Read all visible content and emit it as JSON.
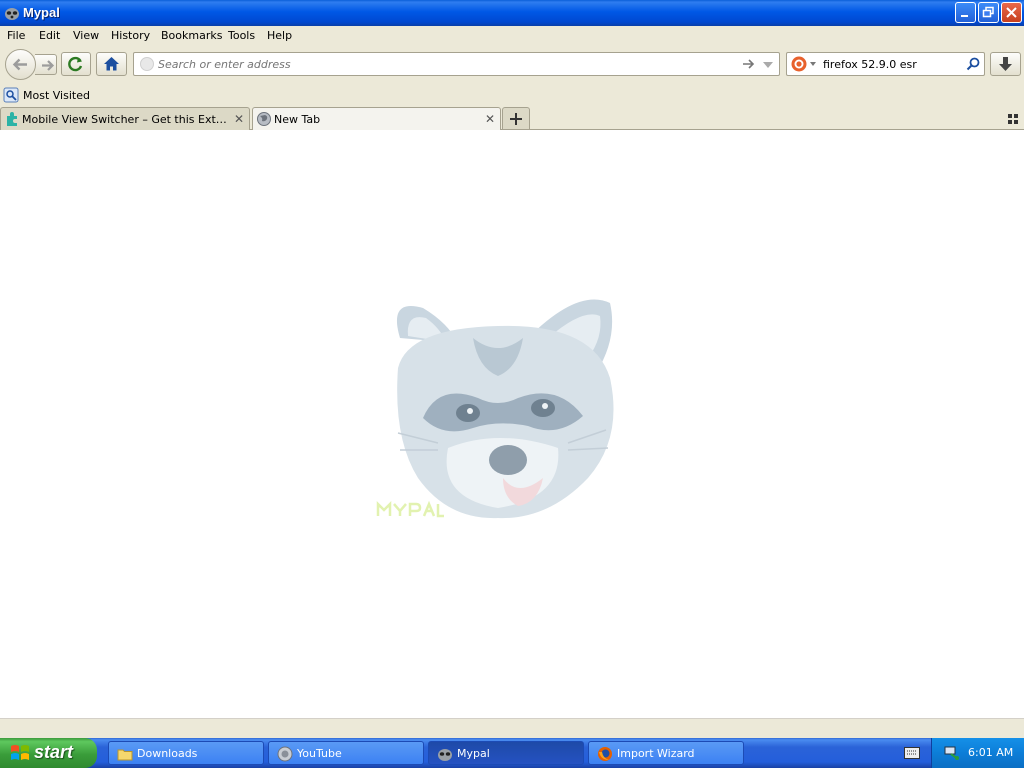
{
  "window": {
    "title": "Mypal"
  },
  "menu": {
    "file": "File",
    "edit": "Edit",
    "view": "View",
    "history": "History",
    "bookmarks": "Bookmarks",
    "tools": "Tools",
    "help": "Help"
  },
  "nav": {
    "url_placeholder": "Search or enter address",
    "url_value": "",
    "search_value": "firefox 52.9.0 esr"
  },
  "bookmarks": {
    "most_visited": "Most Visited"
  },
  "tabs": [
    {
      "label": "Mobile View Switcher – Get this Extension...",
      "selected": false
    },
    {
      "label": "New Tab",
      "selected": true
    }
  ],
  "taskbar": {
    "start": "start",
    "items": [
      {
        "label": "Downloads",
        "active": false
      },
      {
        "label": "YouTube",
        "active": false
      },
      {
        "label": "Mypal",
        "active": true
      },
      {
        "label": "Import Wizard",
        "active": false
      }
    ],
    "clock": "6:01 AM"
  },
  "colors": {
    "titlebar": "#0058e6",
    "chrome": "#ece9d8",
    "taskbar": "#245edb",
    "start_green": "#3a9d3a"
  }
}
